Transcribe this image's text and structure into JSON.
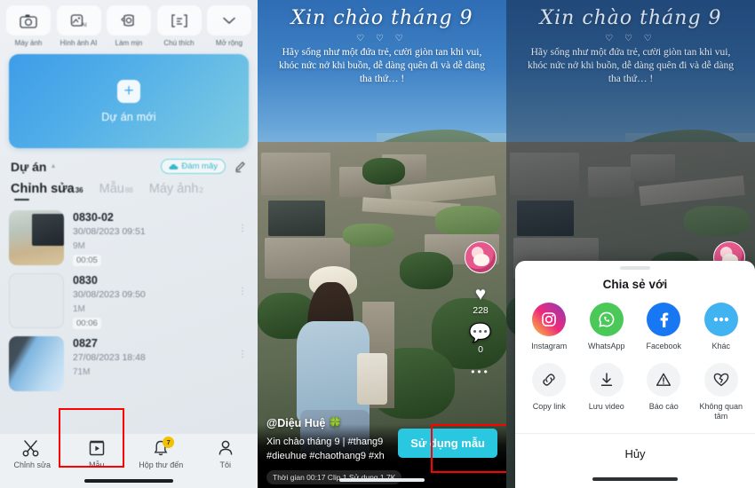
{
  "panel_gallery": {
    "toolbar": [
      {
        "label": "Máy ảnh",
        "icon": "camera-icon"
      },
      {
        "label": "Hình ảnh AI",
        "icon": "ai-image-icon"
      },
      {
        "label": "Làm mịn",
        "icon": "retouch-icon"
      },
      {
        "label": "Chú thích",
        "icon": "caption-icon"
      },
      {
        "label": "Mở rộng",
        "icon": "chevron-down-icon"
      }
    ],
    "new_project": {
      "label": "Dự án mới",
      "icon": "plus-icon"
    },
    "projects_header": {
      "title": "Dự án",
      "cloud_label": "Đám mây",
      "cloud_icon": "cloud-icon",
      "edit_icon": "pencil-icon",
      "accent": "#35b9c9"
    },
    "tabs": [
      {
        "label": "Chỉnh sửa",
        "count": "36",
        "active": true
      },
      {
        "label": "Mẫu",
        "count": "88",
        "active": false
      },
      {
        "label": "Máy ảnh",
        "count": "2",
        "active": false
      }
    ],
    "items": [
      {
        "name": "0830-02",
        "date": "30/08/2023 09:51",
        "size": "9M",
        "duration": "00:05"
      },
      {
        "name": "0830",
        "date": "30/08/2023 09:50",
        "size": "1M",
        "duration": "00:06"
      },
      {
        "name": "0827",
        "date": "27/08/2023 18:48",
        "size": "71M",
        "duration": ""
      }
    ],
    "bottom_nav": [
      {
        "label": "Chỉnh sửa",
        "icon": "scissors-icon",
        "badge": ""
      },
      {
        "label": "Mẫu",
        "icon": "template-icon",
        "badge": "",
        "highlighted": true
      },
      {
        "label": "Hộp thư đến",
        "icon": "bell-icon",
        "badge": "7"
      },
      {
        "label": "Tôi",
        "icon": "person-icon",
        "badge": ""
      }
    ]
  },
  "panel_video": {
    "overlay": {
      "title": "Xin chào tháng 9",
      "hearts": "♡ ♡ ♡",
      "quote": "Hãy sống như một đứa trẻ, cười giòn tan khi vui, khóc nức nở khi buồn, dễ dàng quên đi và dễ dàng tha thứ… !"
    },
    "rail": {
      "avatar_icon": "avatar",
      "like_icon": "heart-icon",
      "like_count": "228",
      "comment_icon": "comment-icon",
      "comment_count": "0",
      "more_icon": "more-dots-icon"
    },
    "username": "@Diệu Huệ 🍀",
    "caption": "Xin chào tháng 9 | #thang9",
    "hashtags": "#dieuhue  #chaothang9  #xh",
    "meta": "Thời gian 00:17 Clip 1 Sử dụng 1.7K",
    "use_template_button": "Sử dụng mẫu",
    "use_template_color": "#2ac7e0"
  },
  "share_sheet": {
    "title": "Chia sẻ với",
    "row1": [
      {
        "label": "Instagram",
        "icon": "instagram-icon"
      },
      {
        "label": "WhatsApp",
        "icon": "whatsapp-icon"
      },
      {
        "label": "Facebook",
        "icon": "facebook-icon"
      },
      {
        "label": "Khác",
        "icon": "more-dots-icon"
      }
    ],
    "row2": [
      {
        "label": "Copy link",
        "icon": "link-icon"
      },
      {
        "label": "Lưu video",
        "icon": "download-icon",
        "highlighted": true
      },
      {
        "label": "Báo cáo",
        "icon": "warning-icon"
      },
      {
        "label": "Không quan tâm",
        "icon": "broken-heart-icon"
      }
    ],
    "cancel": "Hủy"
  }
}
